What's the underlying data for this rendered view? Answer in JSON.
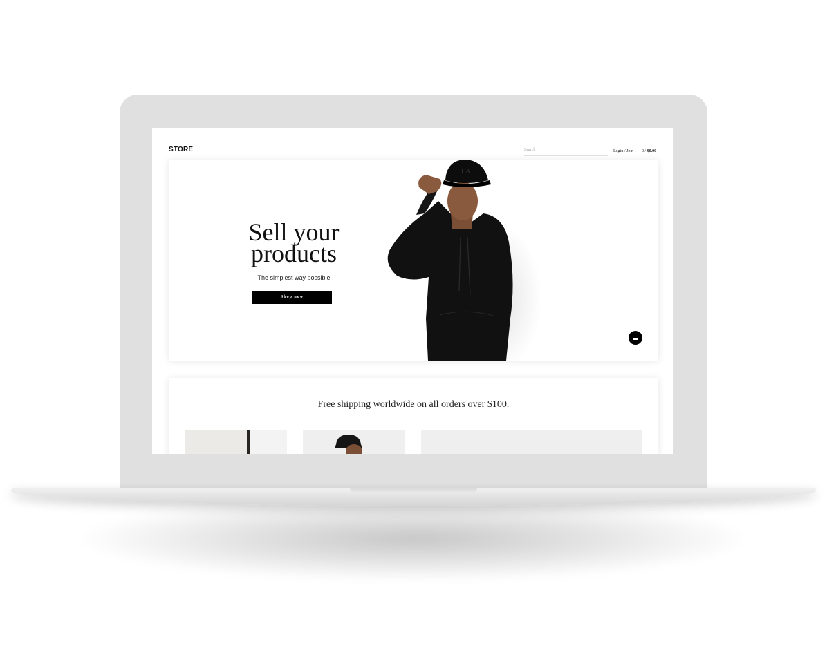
{
  "header": {
    "logo": "STORE",
    "search_placeholder": "Search",
    "login_label": "Login / Join",
    "cart_count": "0",
    "cart_total": "$0.00"
  },
  "hero": {
    "title_line1": "Sell your",
    "title_line2": "products",
    "subtitle": "The simplest way possible",
    "cta_label": "Shop now"
  },
  "promo": {
    "shipping_text": "Free shipping worldwide on all orders over $100."
  },
  "colors": {
    "accent": "#000000",
    "frame": "#e0e0e0",
    "background": "#ffffff"
  }
}
